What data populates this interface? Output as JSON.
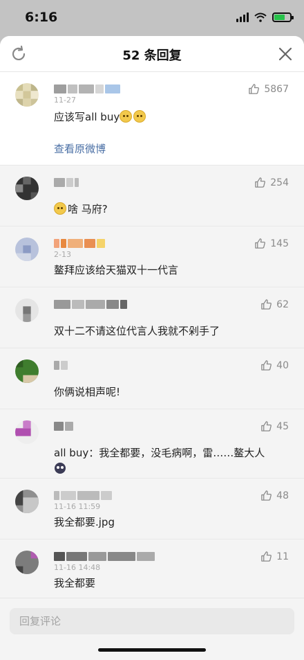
{
  "status_bar": {
    "time": "6:16"
  },
  "header": {
    "title": "52 条回复"
  },
  "root_comment": {
    "likes": "5867",
    "time": "11-27",
    "text": "应该写all buy",
    "view_link": "查看原微博"
  },
  "replies": [
    {
      "text": "啥 马府?",
      "likes": "254",
      "time": ""
    },
    {
      "text": "鳌拜应该给天猫双十一代言",
      "likes": "145",
      "time": "2-13"
    },
    {
      "text": "双十二不请这位代言人我就不剁手了",
      "likes": "62",
      "time": ""
    },
    {
      "text": "你俩说相声呢!",
      "likes": "40",
      "time": ""
    },
    {
      "text": "all buy：我全都要，没毛病啊，雷……鳌大人",
      "likes": "45",
      "time": ""
    },
    {
      "text": "我全都要.jpg",
      "likes": "48",
      "time": "11-16 11:59"
    },
    {
      "text": "我全都要",
      "likes": "11",
      "time": "11-16 14:48"
    }
  ],
  "input": {
    "placeholder": "回复评论"
  },
  "colors": {
    "link": "#4a6fa5",
    "battery": "#27c24a"
  }
}
